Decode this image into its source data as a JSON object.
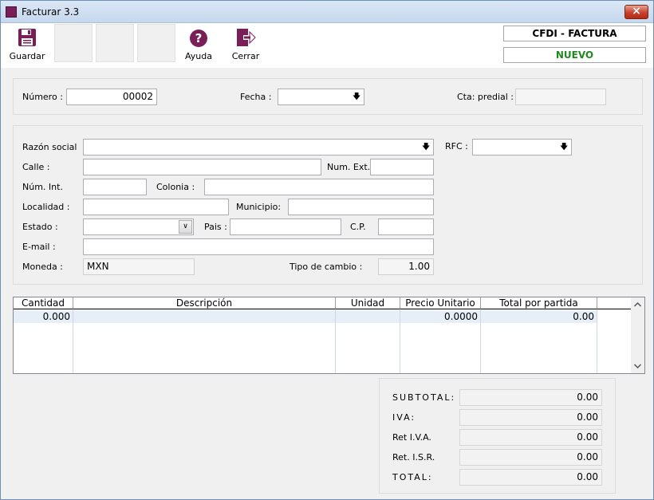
{
  "window": {
    "title": "Facturar 3.3",
    "close_glyph": "×"
  },
  "toolbar": {
    "guardar": "Guardar",
    "ayuda": "Ayuda",
    "cerrar": "Cerrar"
  },
  "status": {
    "doc_type": "CFDI - FACTURA",
    "state": "NUEVO",
    "state_color": "#1f8a1f"
  },
  "header": {
    "numero_label": "Número :",
    "numero_value": "00002",
    "fecha_label": "Fecha :",
    "fecha_value": "",
    "cta_label": "Cta: predial :",
    "cta_value": ""
  },
  "client": {
    "razon_label": "Razón social",
    "razon_value": "",
    "rfc_label": "RFC :",
    "rfc_value": "",
    "calle_label": "Calle :",
    "calle_value": "",
    "num_ext_label": "Num. Ext.",
    "num_ext_value": "",
    "num_int_label": "Núm. Int.",
    "num_int_value": "",
    "colonia_label": "Colonia :",
    "colonia_value": "",
    "localidad_label": "Localidad :",
    "localidad_value": "",
    "municipio_label": "Municipio:",
    "municipio_value": "",
    "estado_label": "Estado :",
    "estado_value": "",
    "pais_label": "Pais :",
    "pais_value": "",
    "cp_label": "C.P.",
    "cp_value": "",
    "email_label": "E-mail :",
    "email_value": "",
    "moneda_label": "Moneda :",
    "moneda_value": "MXN",
    "tipo_cambio_label": "Tipo de cambio :",
    "tipo_cambio_value": "1.00"
  },
  "grid": {
    "columns": [
      "Cantidad",
      "Descripción",
      "Unidad",
      "Precio Unitario",
      "Total por partida"
    ],
    "rows": [
      {
        "cantidad": "0.000",
        "descripcion": "",
        "unidad": "",
        "precio": "0.0000",
        "total": "0.00"
      }
    ]
  },
  "totals": {
    "subtotal_label": "SUBTOTAL:",
    "subtotal_value": "0.00",
    "iva_label": "IVA:",
    "iva_value": "0.00",
    "ret_iva_label": "Ret I.V.A.",
    "ret_iva_value": "0.00",
    "ret_isr_label": "Ret. I.S.R.",
    "ret_isr_value": "0.00",
    "total_label": "TOTAL:",
    "total_value": "0.00"
  },
  "colors": {
    "accent": "#7a1e58"
  },
  "icons": {
    "save": "save-icon",
    "help": "help-icon",
    "exit": "exit-icon"
  }
}
